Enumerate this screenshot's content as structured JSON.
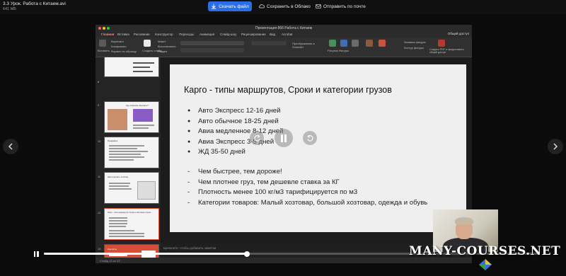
{
  "viewer": {
    "file_name": "3.3 Урок. Работа с Китаем.avi",
    "file_size": "641 МБ",
    "download_label": "Скачать файл",
    "save_cloud_label": "Сохранить в Облако",
    "send_mail_label": "Отправить по почте",
    "progress_fraction": 0.41
  },
  "app": {
    "window_title": "Презентация 866 Работа с Китаем",
    "menu": [
      "Главная",
      "Вставка",
      "Рисование",
      "Конструктор",
      "Переходы",
      "Анимация",
      "Слайд-шоу",
      "Рецензирование",
      "Вид",
      "Acrobat"
    ],
    "share_label": "Общий доступ",
    "ribbon": {
      "paste": "Вставить",
      "copy": "Вырезать",
      "format": "Копировать",
      "format_painter": "Формат по образцу",
      "new_slide": "Создать слайд",
      "layout": "Макет",
      "reset": "Восстановить",
      "section": "Раздел",
      "convert": "Преобразовать в SmartArt",
      "pictures": "Рисунок",
      "shapes": "Фигуры",
      "textbox": "Текстовое поле",
      "arrange": "Упорядочить",
      "quick_styles": "Экспресс-стили",
      "shape_fill": "Заливка фигуры",
      "shape_outline": "Контур фигуры",
      "create_pdf": "Создать PDF и предоставить общий доступ"
    },
    "notes_placeholder": "Щелкните, чтобы добавить заметки",
    "status": "Слайд 13 из 33"
  },
  "thumbnails": [
    {
      "num": "8"
    },
    {
      "num": "9"
    },
    {
      "num": "10"
    },
    {
      "num": "11"
    },
    {
      "num": "12"
    },
    {
      "num": "13"
    }
  ],
  "thumbnail_titles": {
    "t9": "Где сначала покупать?",
    "t10": "Продавцы",
    "t11": "Как покупать в Китае",
    "t12": "Карго - типы маршрутов, Сроки и категории грузов",
    "t13": "Контакты"
  },
  "slide": {
    "title": "Карго - типы маршрутов, Сроки и категории грузов",
    "bullets": [
      "Авто Экспресс 12-16 дней",
      "Авто обычное 18-25 дней",
      "Авиа медленное 8-12 дней",
      "Авиа Экспресс 3-5 дней",
      "ЖД 35-50 дней"
    ],
    "dashes": [
      "Чем быстрее, тем дороже!",
      "Чем плотнее груз, тем дешевле ставка за КГ",
      "Плотность менее 100 кг/м3 тарифицируется по м3",
      "Категории товаров: Малый хозтовар, большой хозтовар, одежда и обувь"
    ]
  },
  "watermark": "MANY-COURSES.NET"
}
